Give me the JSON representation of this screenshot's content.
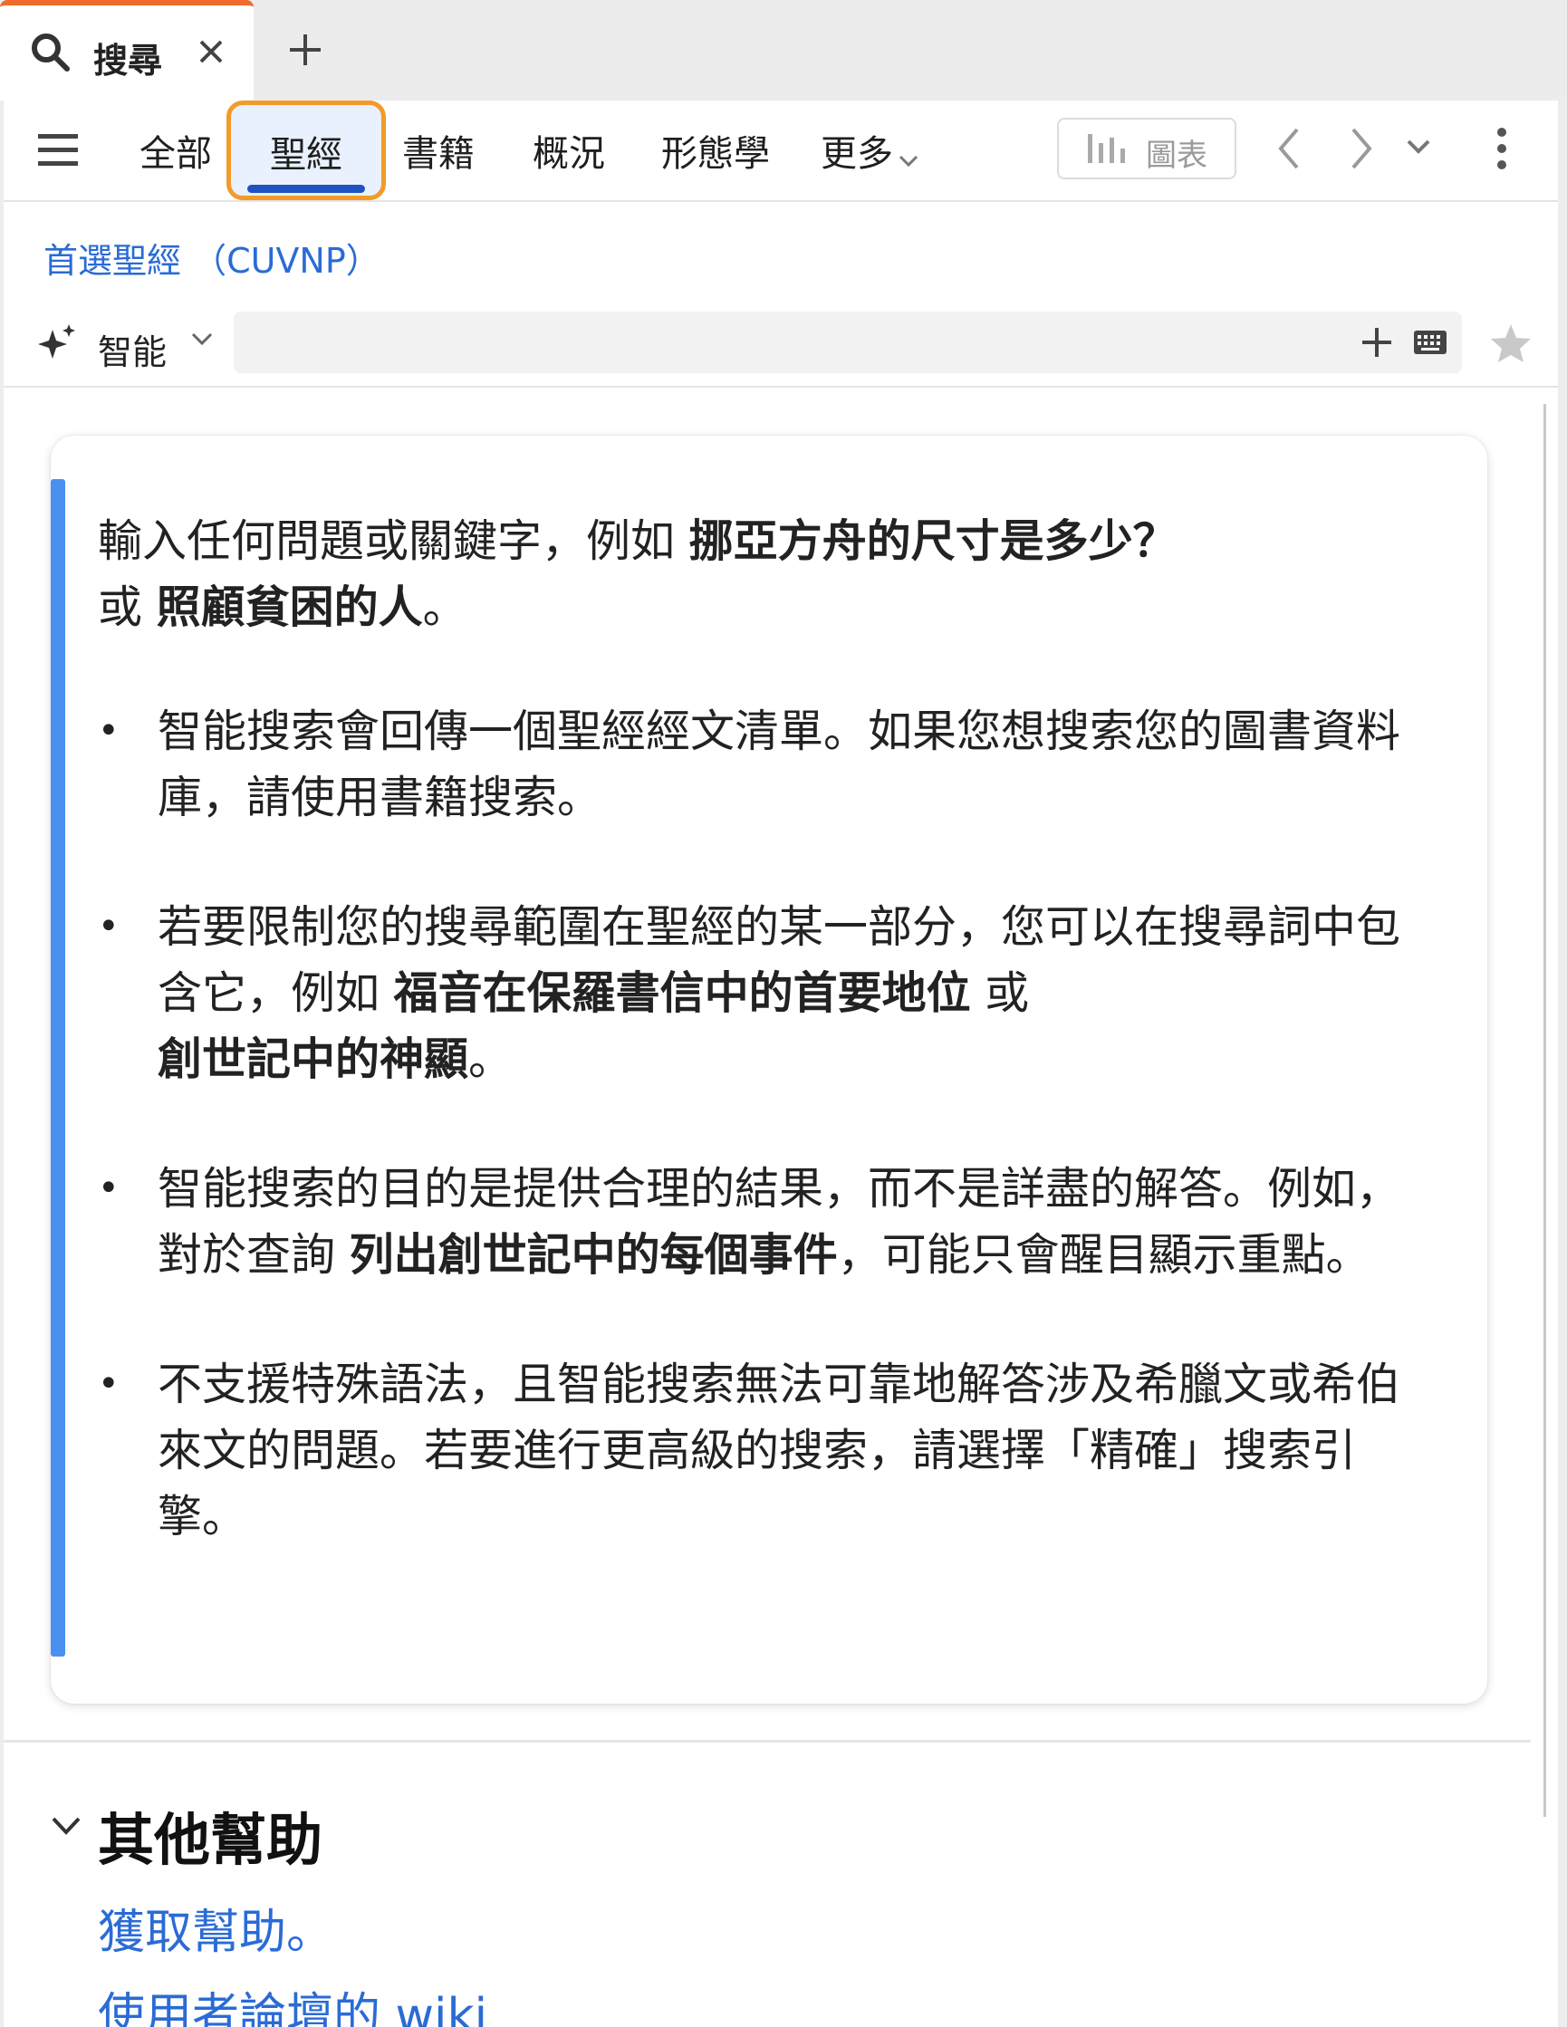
{
  "tab": {
    "title": "搜尋",
    "new_tab_icon": "plus-icon"
  },
  "nav": {
    "tabs": [
      {
        "label": "全部"
      },
      {
        "label": "聖經",
        "active": true
      },
      {
        "label": "書籍"
      },
      {
        "label": "概況"
      },
      {
        "label": "形態學"
      },
      {
        "label": "更多"
      }
    ],
    "chart_button": "圖表"
  },
  "bible": {
    "label": "首選聖經 （CUVNP）"
  },
  "search": {
    "mode": "智能",
    "value": ""
  },
  "help": {
    "intro": {
      "prefix": "輸入任何問題或關鍵字，例如 ",
      "example1": "挪亞方舟的尺寸是多少？",
      "middle": "或 ",
      "example2": "照顧貧困的人",
      "suffix": "。"
    },
    "bullets": [
      {
        "text": "智能搜索會回傳一個聖經經文清單。如果您想搜索您的圖書資料庫，請使用書籍搜索。"
      },
      {
        "prefix": "若要限制您的搜尋範圍在聖經的某一部分，您可以在搜尋詞中包含它，例如 ",
        "bold1": "福音在保羅書信中的首要地位",
        "middle": " 或 ",
        "bold2": "創世記中的神顯",
        "suffix": "。"
      },
      {
        "prefix": "智能搜索的目的是提供合理的結果，而不是詳盡的解答。例如，對於查詢 ",
        "bold1": "列出創世記中的每個事件",
        "suffix": "，可能只會醒目顯示重點。"
      },
      {
        "text": "不支援特殊語法，且智能搜索無法可靠地解答涉及希臘文或希伯來文的問題。若要進行更高級的搜索，請選擇「精確」搜索引擎。"
      }
    ]
  },
  "other_help": {
    "title": "其他幫助",
    "link1": "獲取幫助。",
    "link2": "使用者論壇的 wiki"
  },
  "colors": {
    "accent": "#4b8ff0",
    "link": "#2a6bd6",
    "active_tab_bg": "#e8f1fd",
    "highlight_border": "#f39a2a",
    "tab_top": "#f06a2b"
  }
}
